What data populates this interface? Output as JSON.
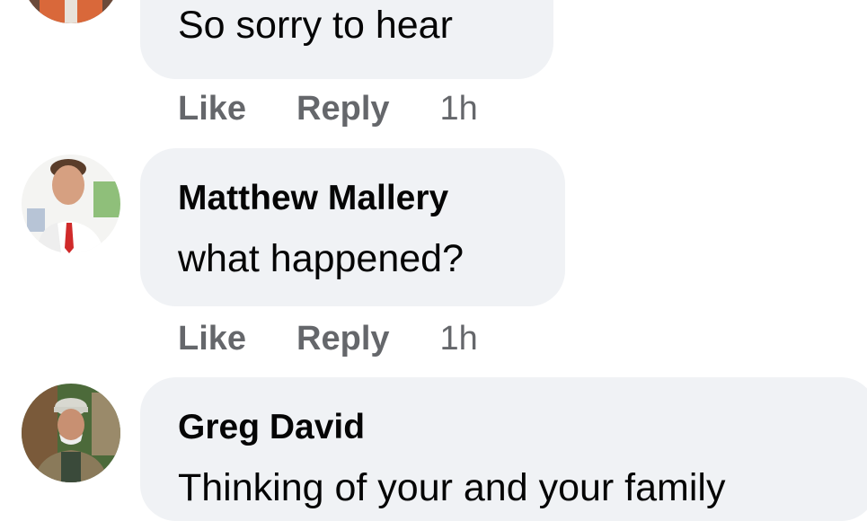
{
  "comments": [
    {
      "author": "",
      "text": "So sorry to hear",
      "actions": {
        "like": "Like",
        "reply": "Reply",
        "time": "1h"
      }
    },
    {
      "author": "Matthew Mallery",
      "text": "what happened?",
      "actions": {
        "like": "Like",
        "reply": "Reply",
        "time": "1h"
      }
    },
    {
      "author": "Greg David",
      "text": "Thinking of your and your family",
      "actions": {
        "like": "",
        "reply": "",
        "time": ""
      }
    }
  ],
  "colors": {
    "bubble_background": "#f0f2f5",
    "author_text": "#050505",
    "action_text": "#65676b"
  }
}
